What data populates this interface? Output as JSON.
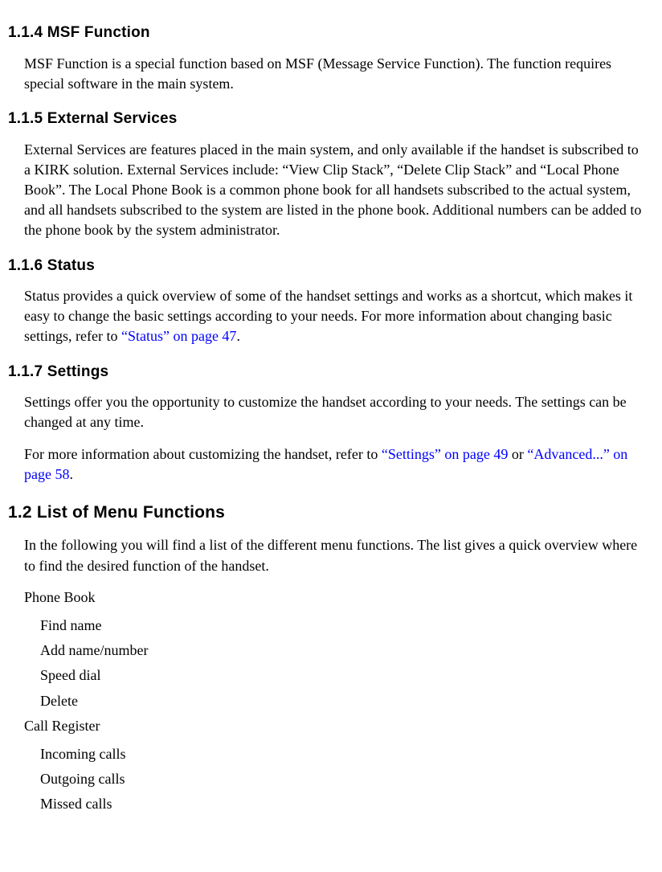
{
  "sections": {
    "msf": {
      "heading": "1.1.4  MSF Function",
      "body": "MSF Function is a special function based on MSF (Message Service Function). The function requires special software in the main system."
    },
    "external": {
      "heading": "1.1.5  External Services",
      "body": "External Services are features placed in the main system, and only available if the handset is subscribed to a KIRK solution. External Services include: “View Clip Stack”, “Delete Clip Stack” and “Local Phone Book”. The Local Phone Book is a common phone book for all handsets subscribed to the actual system, and all handsets subscribed to the system are listed in the phone book. Additional numbers can be added to the phone book by the system administrator."
    },
    "status": {
      "heading": "1.1.6  Status",
      "body_pre": "Status provides a quick overview of some of the handset settings and works as a shortcut, which makes it easy to change the basic settings according to your needs. For more information about changing basic settings, refer to ",
      "link": "“Status” on page 47",
      "body_post": "."
    },
    "settings": {
      "heading": "1.1.7  Settings",
      "body1": "Settings offer you the opportunity to customize the handset according to your needs. The settings can be changed at any time.",
      "body2_pre": "For more information about customizing the handset, refer to ",
      "link1": "“Settings” on page 49",
      "body2_mid": " or ",
      "link2": "“Advanced...” on page 58",
      "body2_post": "."
    },
    "list": {
      "heading": "1.2  List of Menu Functions",
      "intro": "In the following you will find a list of the different menu functions. The list gives a quick overview where to find the desired function of the handset.",
      "phonebook_label": "Phone Book",
      "phonebook_items": {
        "0": "Find name",
        "1": "Add name/number",
        "2": "Speed dial",
        "3": "Delete"
      },
      "callregister_label": "Call Register",
      "callregister_items": {
        "0": "Incoming calls",
        "1": "Outgoing calls",
        "2": "Missed calls"
      }
    }
  }
}
